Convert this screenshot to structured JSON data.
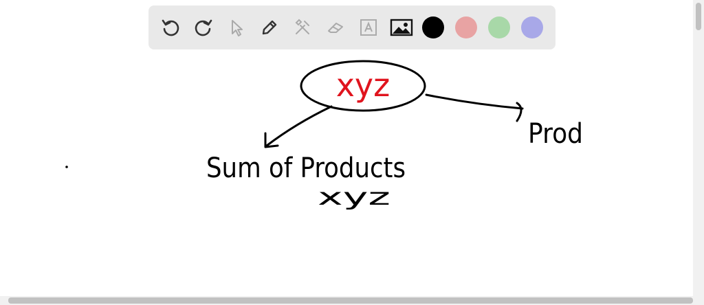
{
  "toolbar": {
    "tools": [
      {
        "icon": "undo-icon"
      },
      {
        "icon": "redo-icon"
      },
      {
        "icon": "pointer-icon"
      },
      {
        "icon": "pencil-icon"
      },
      {
        "icon": "tools-icon"
      },
      {
        "icon": "eraser-icon"
      },
      {
        "icon": "text-icon"
      },
      {
        "icon": "image-icon"
      }
    ],
    "colors": [
      "#000000",
      "#e8a3a3",
      "#a8d8a8",
      "#a8a8e8"
    ]
  },
  "drawing": {
    "center_label": "xyz",
    "left_branch_label": "Sum of Products",
    "left_branch_term": "xyz",
    "right_branch_label": "Prod",
    "accent_color": "#e0141e",
    "ink_color": "#000000"
  }
}
